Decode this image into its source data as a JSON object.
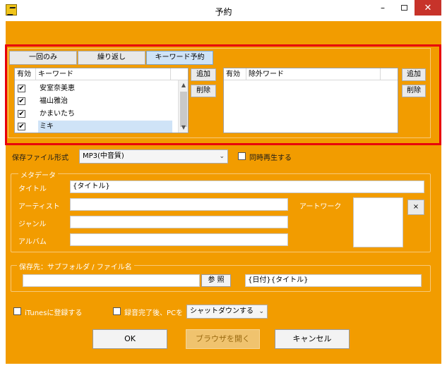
{
  "window": {
    "title": "予約",
    "min_glyph": "–",
    "close_glyph": "✕"
  },
  "tabs": [
    {
      "label": "一回のみ",
      "active": false
    },
    {
      "label": "繰り返し",
      "active": false
    },
    {
      "label": "キーワード予約",
      "active": true
    }
  ],
  "keywords_list": {
    "col_enabled": "有効",
    "col_keyword": "キーワード",
    "rows": [
      {
        "checked": true,
        "text": "安室奈美恵"
      },
      {
        "checked": true,
        "text": "福山雅治"
      },
      {
        "checked": true,
        "text": "かまいたち"
      },
      {
        "checked": true,
        "text": "ミキ"
      }
    ],
    "add_label": "追加",
    "delete_label": "削除"
  },
  "exclude_list": {
    "col_enabled": "有効",
    "col_word": "除外ワード",
    "add_label": "追加",
    "delete_label": "削除"
  },
  "format": {
    "label": "保存ファイル形式",
    "value": "MP3(中音質)",
    "simultaneous_label": "同時再生する"
  },
  "metadata": {
    "group_title": "メタデータ",
    "title_label": "タイトル",
    "title_value": "{タイトル}",
    "artist_label": "アーティスト",
    "artist_value": "",
    "genre_label": "ジャンル",
    "genre_value": "",
    "album_label": "アルバム",
    "album_value": "",
    "artwork_label": "アートワーク",
    "artwork_clear_label": "×"
  },
  "save": {
    "group_title": "保存先：サブフォルダ / ファイル名",
    "folder_value": "",
    "browse_label": "参 照",
    "filename_value": "{日付}{タイトル}"
  },
  "options": {
    "itunes_label": "iTunesに登録する",
    "after_record_label": "録音完了後、PCを",
    "shutdown_value": "シャットダウンする"
  },
  "buttons": {
    "ok": "OK",
    "open_browser": "ブラウザを開く",
    "cancel": "キャンセル"
  }
}
